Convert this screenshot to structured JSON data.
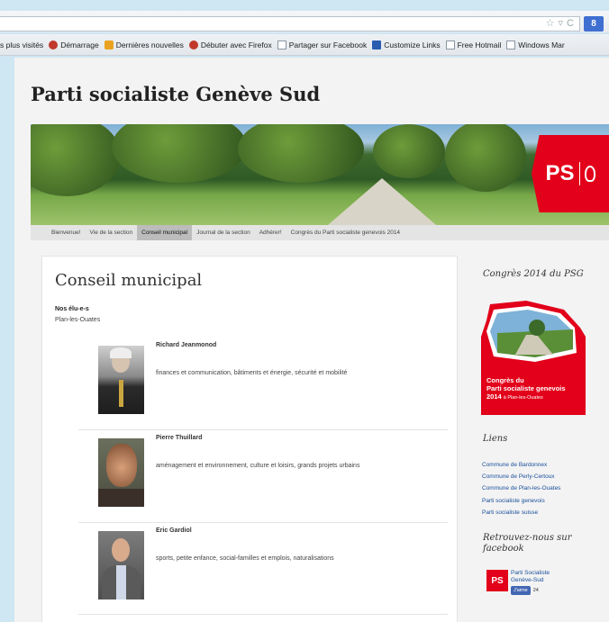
{
  "browser": {
    "bookmarks": [
      {
        "label": "s plus visités",
        "icon": "page-icon"
      },
      {
        "label": "Démarrage",
        "icon": "firefox-icon"
      },
      {
        "label": "Dernières nouvelles",
        "icon": "rss-icon"
      },
      {
        "label": "Débuter avec Firefox",
        "icon": "firefox-icon"
      },
      {
        "label": "Partager sur Facebook",
        "icon": "page-icon"
      },
      {
        "label": "Customize Links",
        "icon": "m-icon"
      },
      {
        "label": "Free Hotmail",
        "icon": "page-icon"
      },
      {
        "label": "Windows Mar",
        "icon": "page-icon"
      }
    ],
    "search_button": "8"
  },
  "site": {
    "title": "Parti socialiste Genève Sud",
    "logo_text": "PS",
    "nav": [
      {
        "label": "Bienvenue!",
        "active": false
      },
      {
        "label": "Vie de la section",
        "active": false
      },
      {
        "label": "Conseil municipal",
        "active": true
      },
      {
        "label": "Journal de la section",
        "active": false
      },
      {
        "label": "Adhérer!",
        "active": false
      },
      {
        "label": "Congrès du Parti socialiste genevois 2014",
        "active": false
      }
    ]
  },
  "main": {
    "page_title": "Conseil municipal",
    "heading": "Nos élu-e-s",
    "subheading": "Plan-les-Ouates",
    "members": [
      {
        "name": "Richard Jeanmonod",
        "role": "finances et communication, bâtiments et énergie, sécurité et mobilité"
      },
      {
        "name": "Pierre Thuillard",
        "role": "aménagement et environnement, culture et loisirs, grands projets urbains"
      },
      {
        "name": "Eric Gardiol",
        "role": "sports, petite enfance, social-familles et emplois, naturalisations"
      }
    ]
  },
  "sidebar": {
    "congres_title": "Congrès 2014 du PSG",
    "congres_banner": {
      "line1": "Congrès du",
      "line2": "Parti socialiste genevois",
      "year": "2014",
      "place": "à Plan-les-Ouates"
    },
    "links_title": "Liens",
    "links": [
      "Commune de Bardonnex",
      "Commune de Perly-Certoux",
      "Commune de Plan-les-Ouates",
      "Parti socialiste genevois",
      "Parti socialiste suisse"
    ],
    "facebook_title": "Retrouvez-nous sur facebook",
    "facebook_page": {
      "logo": "PS",
      "line1": "Parti Socialiste",
      "line2": "Genève-Sud",
      "like_label": "J'aime",
      "like_count": "24"
    }
  },
  "colors": {
    "ps_red": "#e2001a",
    "link_blue": "#1a4f9c"
  }
}
